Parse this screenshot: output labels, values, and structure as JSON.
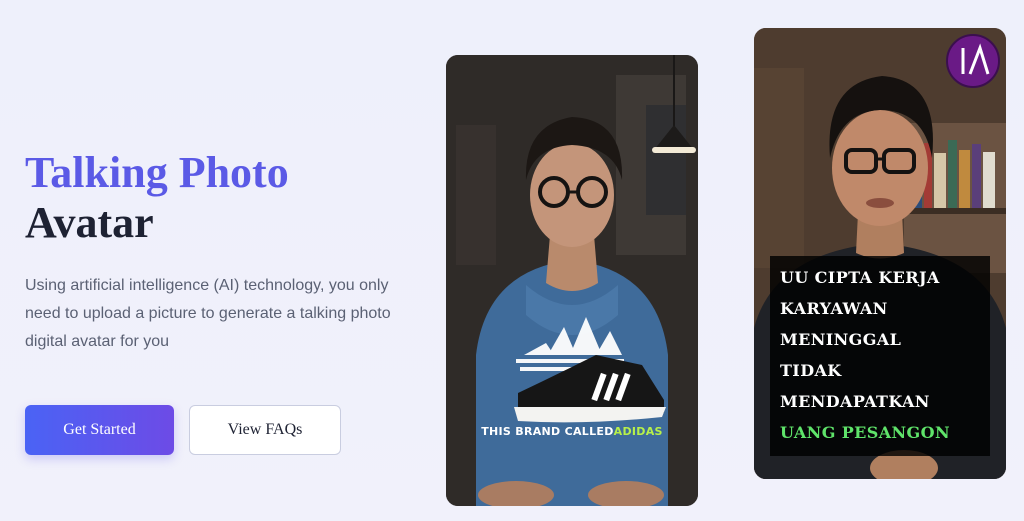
{
  "hero": {
    "title_accent": "Talking Photo",
    "title_dark": "Avatar",
    "description": "Using artificial intelligence (AI) technology, you only need to upload a picture to generate a talking photo digital avatar for you"
  },
  "buttons": {
    "primary_label": "Get Started",
    "secondary_label": "View FAQs"
  },
  "cards": {
    "left": {
      "caption_prefix": "THIS BRAND CALLED",
      "caption_highlight": "ADIDAS"
    },
    "right": {
      "lines": [
        "UU CIPTA KERJA",
        "KARYAWAN MENINGGAL",
        "TIDAK MENDAPATKAN"
      ],
      "highlight": "UANG PESANGON"
    }
  },
  "colors": {
    "accent": "#5b5ae6",
    "title_dark": "#1e2233",
    "button_gradient_start": "#4a63f5",
    "button_gradient_end": "#6d4be6",
    "caption_highlight_left": "#b7f04a",
    "caption_highlight_right": "#5fe36a"
  },
  "icons": {
    "logo": "la-logo-icon"
  }
}
